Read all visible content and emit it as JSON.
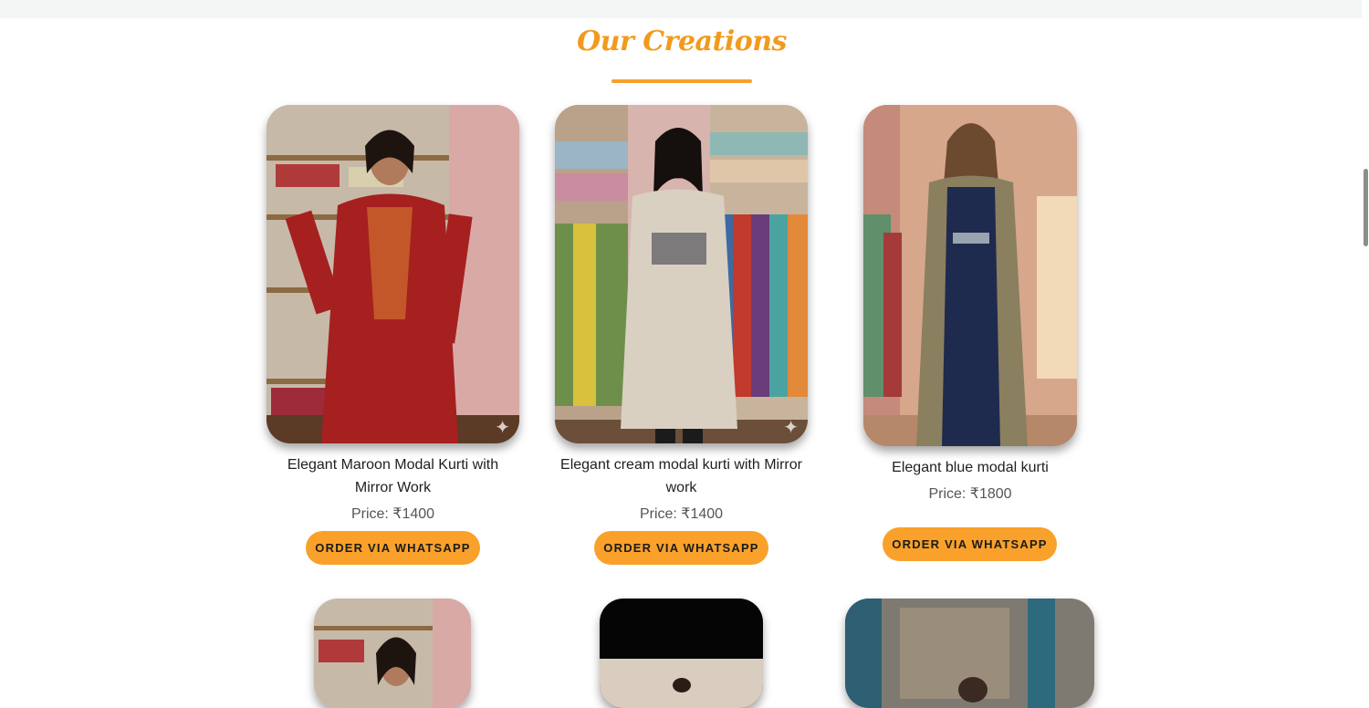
{
  "section": {
    "title": "Our Creations"
  },
  "products": [
    {
      "title": "Elegant Maroon Modal Kurti with Mirror Work",
      "price": "Price: ₹1400",
      "button": "ORDER VIA WHATSAPP",
      "garment_color": "#a5201f"
    },
    {
      "title": "Elegant cream modal kurti with Mirror work",
      "price": "Price: ₹1400",
      "button": "ORDER VIA WHATSAPP",
      "garment_color": "#d9d0c2"
    },
    {
      "title": "Elegant blue modal kurti",
      "price": "Price: ₹1800",
      "button": "ORDER VIA WHATSAPP",
      "garment_color": "#1f2a4f"
    }
  ],
  "colors": {
    "accent": "#f9a12a",
    "title": "#f29a1c"
  },
  "icons": {
    "sparkle": "✦"
  }
}
